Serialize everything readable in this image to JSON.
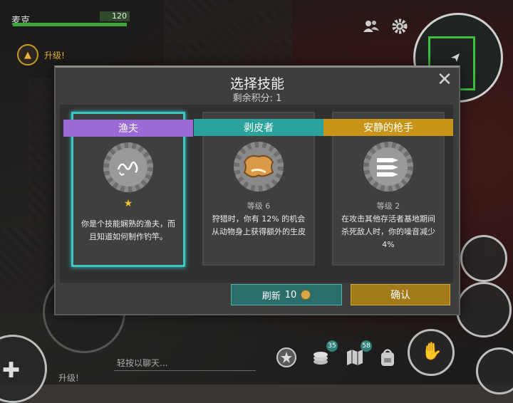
{
  "hud": {
    "player_name": "麦克",
    "health_value": "120",
    "upgrade_label": "升级!",
    "health_fraction": 1.0
  },
  "dialog": {
    "title": "选择技能",
    "points_label": "剩余积分: 1",
    "close_glyph": "✕",
    "cards": [
      {
        "name": "渔夫",
        "ribbon_color": "#9a6ad6",
        "icon": "worm-hook-icon",
        "stars": "★",
        "level": "",
        "description": "你是个技能娴熟的渔夫，而且知道如何制作钓竿。",
        "selected": true
      },
      {
        "name": "剥皮者",
        "ribbon_color": "#2aa39d",
        "icon": "animal-hide-icon",
        "stars": "",
        "level": "等级 6",
        "description": "狩猎时，你有 12% 的机会从动物身上获得额外的生皮",
        "selected": false
      },
      {
        "name": "安静的枪手",
        "ribbon_color": "#c99518",
        "icon": "bullets-icon",
        "stars": "",
        "level": "等级 2",
        "description": "在攻击其他存活者基地期间杀死敌人时，你的噪音减少 4%",
        "selected": false
      }
    ],
    "refresh_label": "刷新",
    "refresh_cost": "10",
    "confirm_label": "确认"
  },
  "bottom": {
    "chat_placeholder": "轻按以聊天...",
    "upgrade_label": "升级!",
    "chat_badge_1": "35",
    "chat_badge_2": "58"
  }
}
